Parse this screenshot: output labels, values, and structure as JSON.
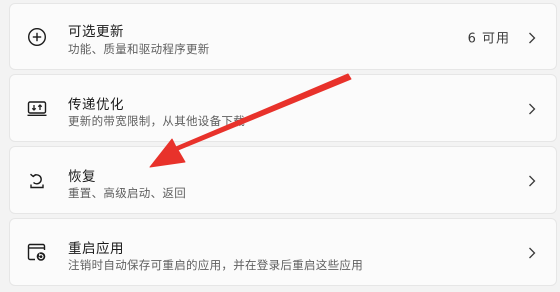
{
  "items": [
    {
      "title": "可选更新",
      "desc": "功能、质量和驱动程序更新",
      "status": "6 可用",
      "icon": "plus-circle-icon"
    },
    {
      "title": "传递优化",
      "desc": "更新的带宽限制，从其他设备下载",
      "icon": "delivery-optimization-icon"
    },
    {
      "title": "恢复",
      "desc": "重置、高级启动、返回",
      "icon": "recovery-icon"
    },
    {
      "title": "重启应用",
      "desc": "注销时自动保存可重启的应用，并在登录后重启这些应用",
      "icon": "restart-apps-icon"
    }
  ],
  "annotation": {
    "color": "#e8322b"
  }
}
